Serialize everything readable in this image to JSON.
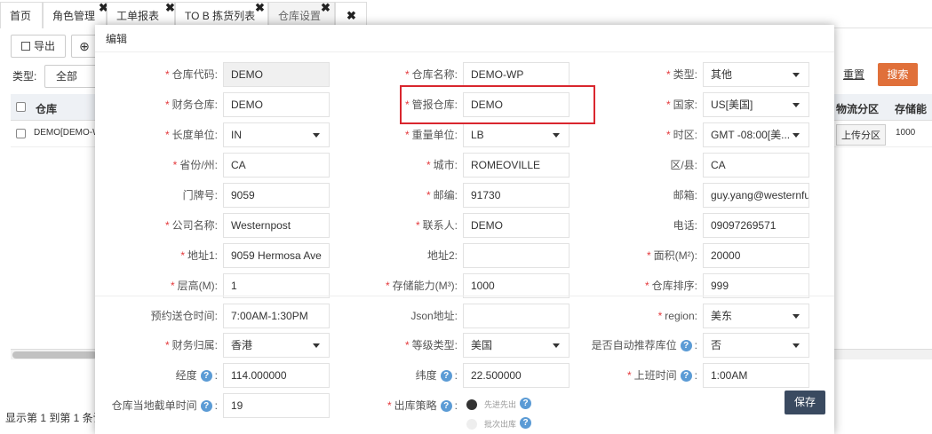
{
  "tabs": [
    {
      "label": "首页",
      "close": ""
    },
    {
      "label": "角色管理",
      "close": "✖"
    },
    {
      "label": "工单报表",
      "close": "✖"
    },
    {
      "label": "TO B 拣货列表",
      "close": "✖"
    },
    {
      "label": "仓库设置",
      "close": "✖"
    },
    {
      "label": "",
      "close": "✖"
    }
  ],
  "background": {
    "export_label": "导出",
    "type_label": "类型:",
    "type_value": "全部",
    "reset_label": "重置",
    "search_label": "搜索",
    "col_warehouse": "仓库",
    "col_logistics": "物流分区",
    "col_storage": "存储能",
    "row_warehouse": "DEMO[DEMO-W",
    "upload_zone": "上传分区",
    "row_storage": "1000",
    "footer": "显示第 1 到第 1 条记录"
  },
  "modal": {
    "title": "编辑",
    "save_label": "保存",
    "rows": [
      [
        {
          "label": "仓库代码:",
          "required": true,
          "value": "DEMO",
          "kind": "ro"
        },
        {
          "label": "仓库名称:",
          "required": true,
          "value": "DEMO-WP",
          "kind": "text"
        },
        {
          "label": "类型:",
          "required": true,
          "value": "其他",
          "kind": "select"
        }
      ],
      [
        {
          "label": "财务仓库:",
          "required": true,
          "value": "DEMO",
          "kind": "text"
        },
        {
          "label": "管报仓库:",
          "required": true,
          "value": "DEMO",
          "kind": "text"
        },
        {
          "label": "国家:",
          "required": true,
          "value": "US[美国]",
          "kind": "select"
        }
      ],
      [
        {
          "label": "长度单位:",
          "required": true,
          "value": "IN",
          "kind": "select"
        },
        {
          "label": "重量单位:",
          "required": true,
          "value": "LB",
          "kind": "select"
        },
        {
          "label": "时区:",
          "required": true,
          "value": "GMT -08:00[美...",
          "kind": "select"
        }
      ],
      [
        {
          "label": "省份/州:",
          "required": true,
          "value": "CA",
          "kind": "text"
        },
        {
          "label": "城市:",
          "required": true,
          "value": "ROMEOVILLE",
          "kind": "text"
        },
        {
          "label": "区/县:",
          "required": false,
          "value": "CA",
          "kind": "text"
        }
      ],
      [
        {
          "label": "门牌号:",
          "required": false,
          "value": "9059",
          "kind": "text"
        },
        {
          "label": "邮编:",
          "required": true,
          "value": "91730",
          "kind": "text"
        },
        {
          "label": "邮箱:",
          "required": false,
          "value": "guy.yang@westernfu",
          "kind": "text"
        }
      ],
      [
        {
          "label": "公司名称:",
          "required": true,
          "value": "Westernpost",
          "kind": "text"
        },
        {
          "label": "联系人:",
          "required": true,
          "value": "DEMO",
          "kind": "text"
        },
        {
          "label": "电话:",
          "required": false,
          "value": "09097269571",
          "kind": "text"
        }
      ],
      [
        {
          "label": "地址1:",
          "required": true,
          "value": "9059 Hermosa Ave",
          "kind": "text"
        },
        {
          "label": "地址2:",
          "required": false,
          "value": "",
          "kind": "text"
        },
        {
          "label": "面积(M²):",
          "required": true,
          "value": "20000",
          "kind": "text"
        }
      ],
      [
        {
          "label": "层高(M):",
          "required": true,
          "value": "1",
          "kind": "text"
        },
        {
          "label": "存储能力(M³):",
          "required": true,
          "value": "1000",
          "kind": "text"
        },
        {
          "label": "仓库排序:",
          "required": true,
          "value": "999",
          "kind": "text"
        }
      ],
      [
        {
          "label": "预约送仓时间:",
          "required": false,
          "value": "7:00AM-1:30PM",
          "kind": "text"
        },
        {
          "label": "Json地址:",
          "required": false,
          "value": "",
          "kind": "text"
        },
        {
          "label": "region:",
          "required": true,
          "value": "美东",
          "kind": "select"
        }
      ],
      [
        {
          "label": "财务归属:",
          "required": true,
          "value": "香港",
          "kind": "select"
        },
        {
          "label": "等级类型:",
          "required": true,
          "value": "美国",
          "kind": "select"
        },
        {
          "label": "是否自动推荐库位",
          "help": true,
          "required": false,
          "value": "否",
          "kind": "select"
        }
      ],
      [
        {
          "label": "经度",
          "help": true,
          "required": false,
          "value": "114.000000",
          "kind": "text"
        },
        {
          "label": "纬度",
          "help": true,
          "required": false,
          "value": "22.500000",
          "kind": "text"
        },
        {
          "label": "上班时间",
          "help": true,
          "required": true,
          "value": "1:00AM",
          "kind": "text"
        }
      ],
      [
        {
          "label": "仓库当地截单时间",
          "help": true,
          "required": false,
          "value": "19",
          "kind": "text"
        },
        {
          "label": "出库策略",
          "help": true,
          "required": true,
          "value": "",
          "kind": "radio"
        }
      ]
    ],
    "radio_options": [
      "先进先出",
      "批次出库"
    ]
  },
  "colors": {
    "accent_search": "#e0703a",
    "save_btn": "#3a4a60",
    "highlight": "#d9262e",
    "required": "#e4393c"
  }
}
